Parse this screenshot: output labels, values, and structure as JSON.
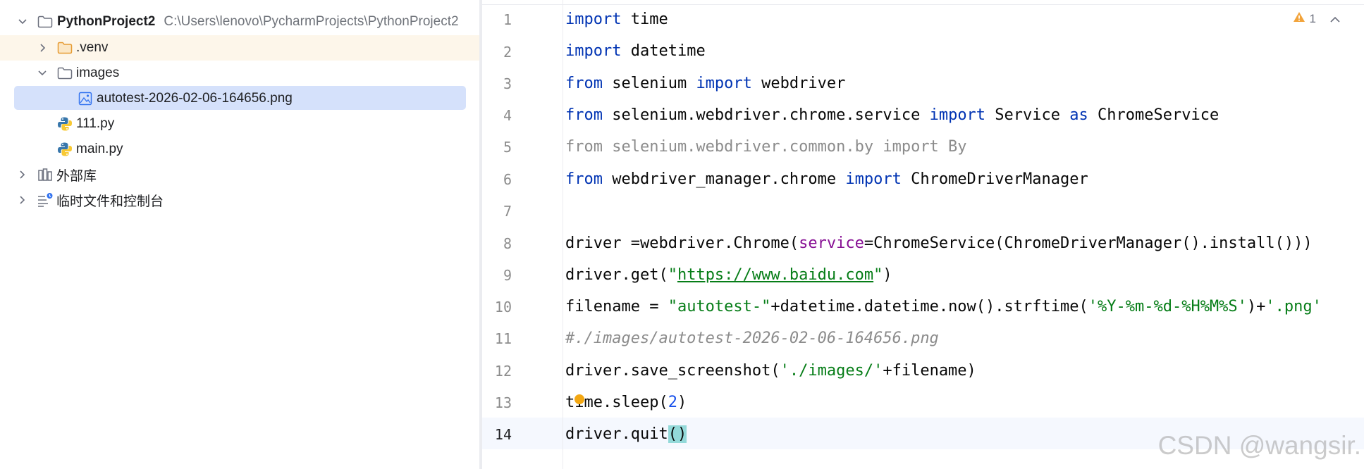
{
  "project": {
    "root_name": "PythonProject2",
    "root_path": "C:\\Users\\lenovo\\PycharmProjects\\PythonProject2",
    "items": [
      {
        "label": ".venv"
      },
      {
        "label": "images"
      },
      {
        "label": "autotest-2026-02-06-164656.png"
      },
      {
        "label": "111.py"
      },
      {
        "label": "main.py"
      },
      {
        "label": "外部库"
      },
      {
        "label": "临时文件和控制台"
      }
    ]
  },
  "editor": {
    "line_numbers": [
      "1",
      "2",
      "3",
      "4",
      "5",
      "6",
      "7",
      "8",
      "9",
      "10",
      "11",
      "12",
      "13",
      "14"
    ],
    "warning_count": "1",
    "lines": [
      [
        "import",
        " time"
      ],
      [
        "import",
        " datetime"
      ],
      [
        "from",
        " selenium ",
        "import",
        " webdriver"
      ],
      [
        "from",
        " selenium.webdriver.chrome.service ",
        "import",
        " Service ",
        "as",
        " ChromeService"
      ],
      [
        "from selenium.webdriver.common.by import By"
      ],
      [
        "from",
        " webdriver_manager.chrome ",
        "import",
        " ChromeDriverManager"
      ],
      [
        ""
      ],
      [
        "driver =webdriver.Chrome(",
        "service",
        "=ChromeService(ChromeDriverManager().install()))"
      ],
      [
        "driver.get(",
        "\"",
        "https://www.baidu.com",
        "\"",
        ")"
      ],
      [
        "filename = ",
        "\"autotest-\"",
        "+datetime.datetime.now().strftime(",
        "'%Y-%m-%d-%H%M%S'",
        ")+",
        "'.png'"
      ],
      [
        "#./images/autotest-2026-02-06-164656.png"
      ],
      [
        "driver.save_screenshot(",
        "'./images/'",
        "+filename)"
      ],
      [
        "time.sleep(",
        "2",
        ")"
      ],
      [
        "driver.quit",
        "(",
        ")"
      ]
    ]
  },
  "watermark": "CSDN @wangsir."
}
